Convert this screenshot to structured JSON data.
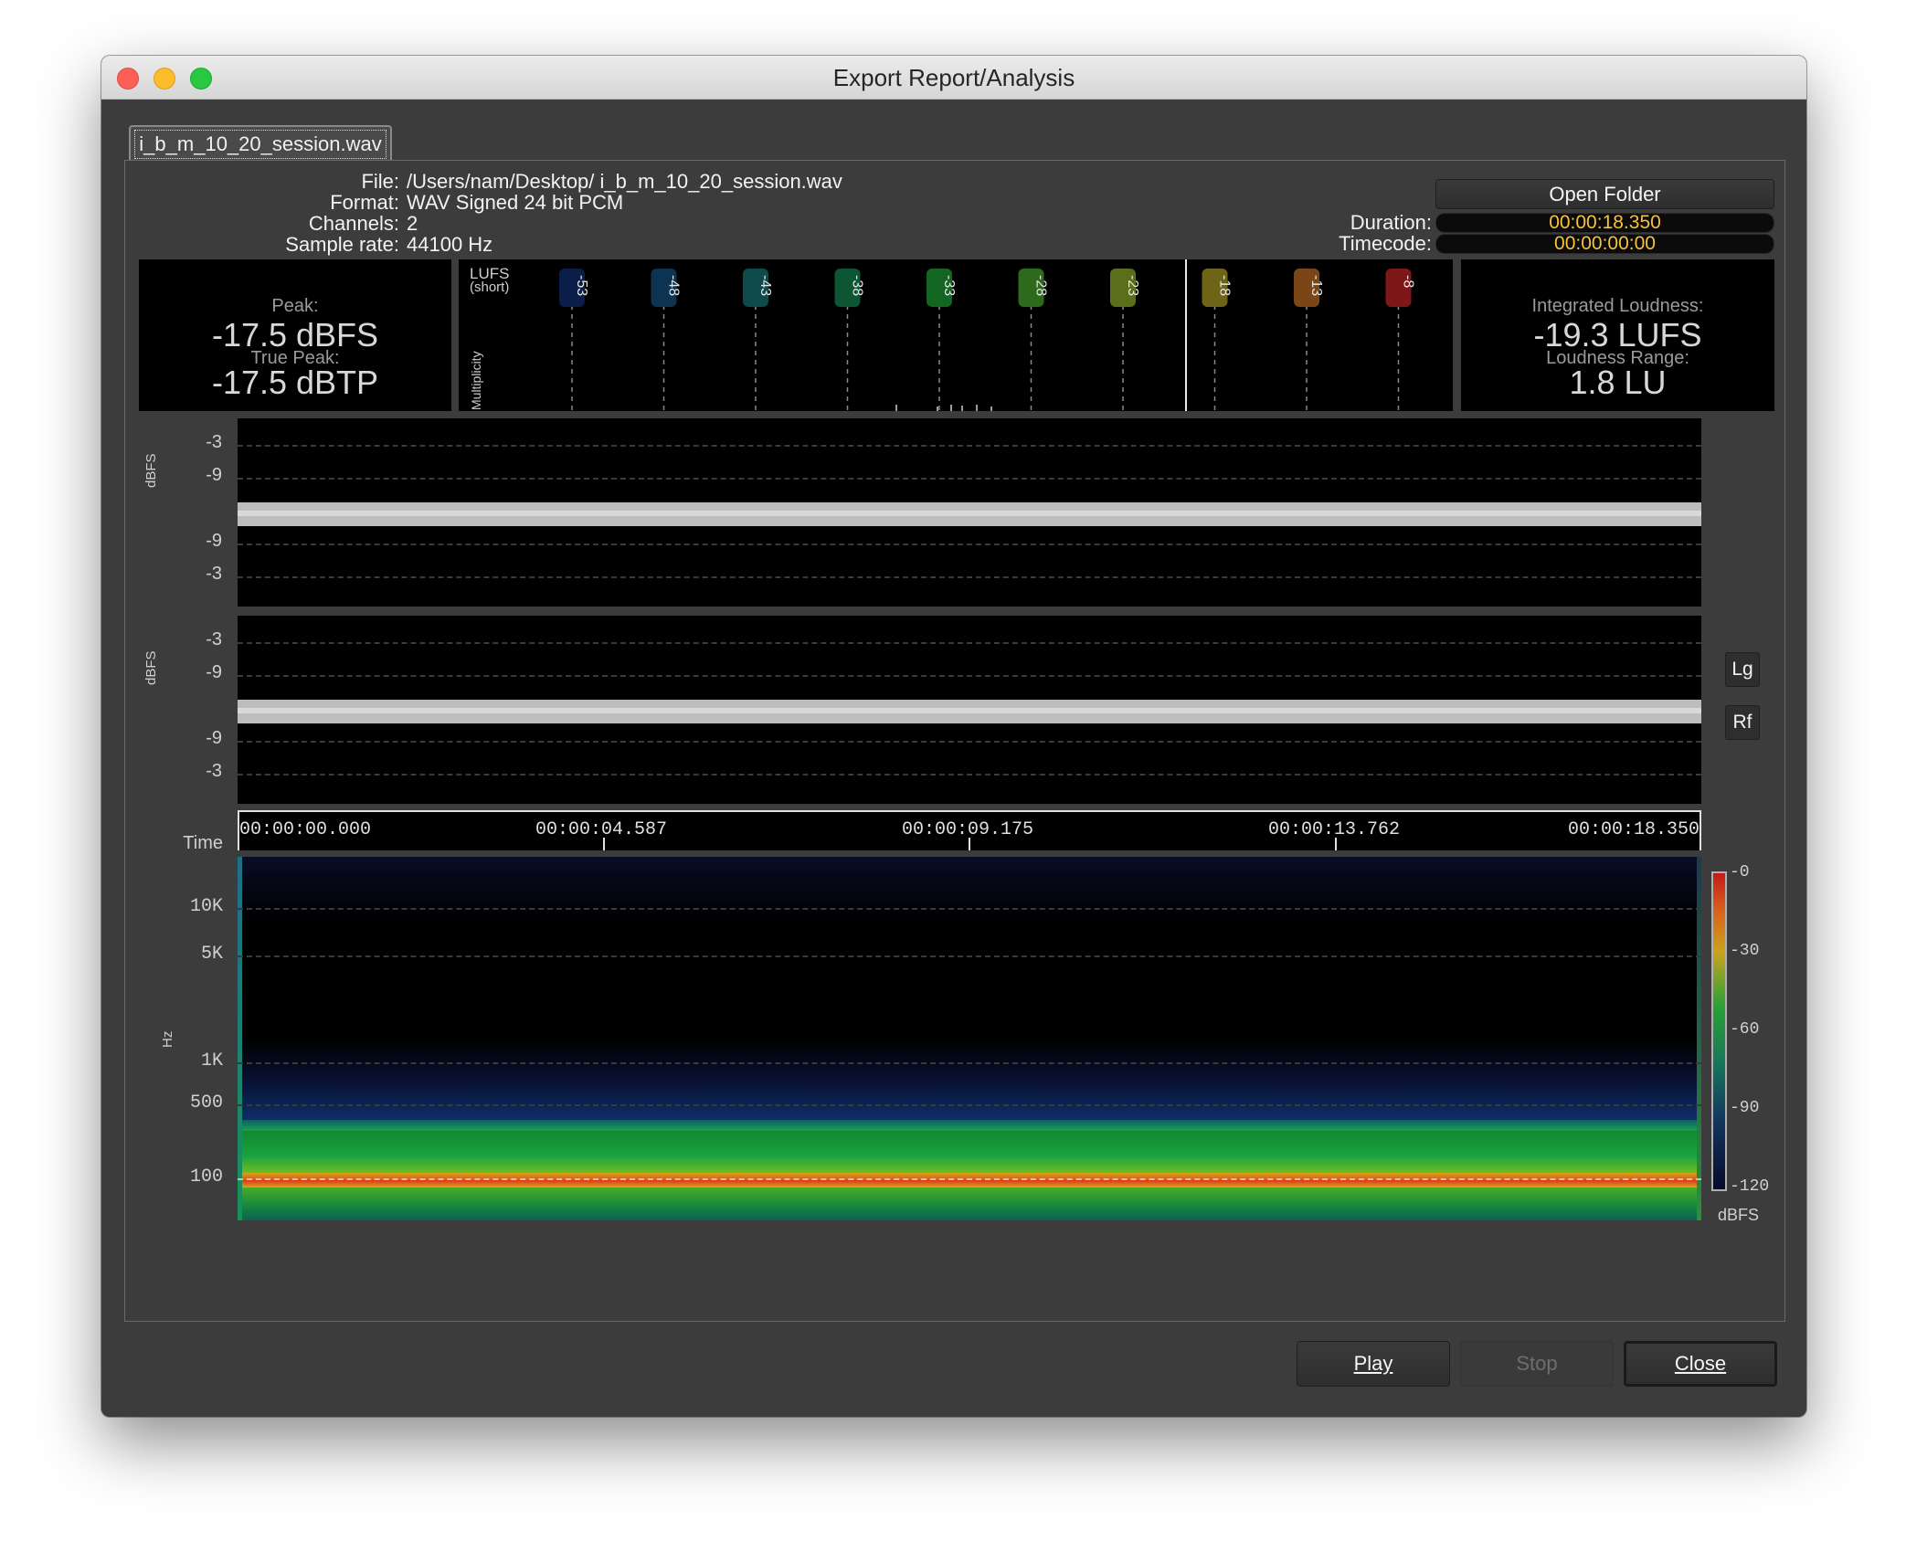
{
  "window": {
    "title": "Export Report/Analysis"
  },
  "tab": {
    "label": "i_b_m_10_20_session.wav"
  },
  "file_info": {
    "file_label": "File:",
    "file_value": "/Users/nam/Desktop/ i_b_m_10_20_session.wav",
    "format_label": "Format:",
    "format_value": "WAV Signed 24 bit PCM",
    "channels_label": "Channels:",
    "channels_value": "2",
    "samplerate_label": "Sample rate:",
    "samplerate_value": "44100 Hz"
  },
  "right_info": {
    "open_folder": "Open Folder",
    "duration_label": "Duration:",
    "duration_value": "00:00:18.350",
    "timecode_label": "Timecode:",
    "timecode_value": "00:00:00:00"
  },
  "peak": {
    "peak_label": "Peak:",
    "peak_value": "-17.5 dBFS",
    "truepeak_label": "True Peak:",
    "truepeak_value": "-17.5 dBTP"
  },
  "loudness": {
    "integrated_label": "Integrated Loudness:",
    "integrated_value": "-19.3 LUFS",
    "range_label": "Loudness Range:",
    "range_value": "1.8 LU"
  },
  "histogram": {
    "title_line1": "LUFS",
    "title_line2": "(short)",
    "y_label": "Multiplicity",
    "markers": [
      {
        "label": "-53",
        "color": "#0b1e4a"
      },
      {
        "label": "-48",
        "color": "#0d3350"
      },
      {
        "label": "-43",
        "color": "#0e4a4a"
      },
      {
        "label": "-38",
        "color": "#0d5533"
      },
      {
        "label": "-33",
        "color": "#136522"
      },
      {
        "label": "-28",
        "color": "#2e6a1c"
      },
      {
        "label": "-23",
        "color": "#5b6e1a"
      },
      {
        "label": "-18",
        "color": "#6d6418"
      },
      {
        "label": "-13",
        "color": "#7a4618"
      },
      {
        "label": "-8",
        "color": "#7e1818"
      }
    ]
  },
  "waveform": {
    "y_unit": "dBFS",
    "tick_labels": [
      "-3",
      "-9",
      "-9",
      "-3"
    ],
    "buttons": {
      "log": "Lg",
      "rectified": "Rf"
    }
  },
  "timeline": {
    "label": "Time",
    "ticks": [
      "00:00:00.000",
      "00:00:04.587",
      "00:00:09.175",
      "00:00:13.762",
      "00:00:18.350"
    ]
  },
  "spectrogram": {
    "y_unit": "Hz",
    "freq_labels": [
      "10K",
      "5K",
      "1K",
      "500",
      "100"
    ],
    "colorbar_labels": [
      "-0",
      "-30",
      "-60",
      "-90",
      "-120"
    ],
    "colorbar_unit": "dBFS"
  },
  "footer": {
    "play": "Play",
    "stop": "Stop",
    "close": "Close"
  },
  "colors": {
    "accent_timecode": "#f7c23a",
    "background": "#3c3c3c",
    "plot_background": "#000000"
  }
}
